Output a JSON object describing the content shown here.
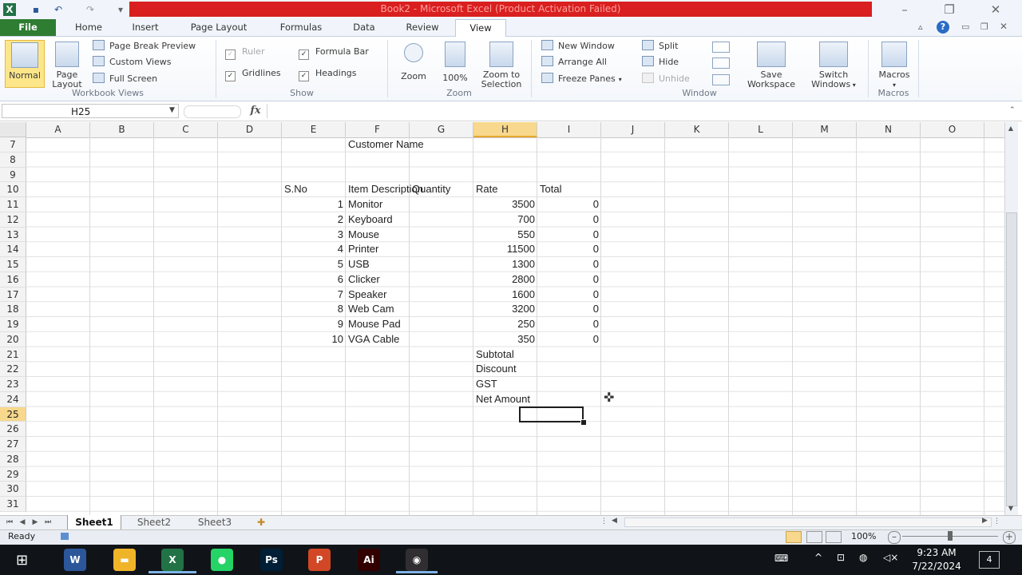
{
  "window": {
    "title": "Book2 - Microsoft Excel (Product Activation Failed)"
  },
  "ribbon_tabs": [
    "File",
    "Home",
    "Insert",
    "Page Layout",
    "Formulas",
    "Data",
    "Review",
    "View"
  ],
  "ribbon": {
    "workbook_views": {
      "label": "Workbook Views",
      "normal": "Normal",
      "page_layout_1": "Page",
      "page_layout_2": "Layout",
      "page_break_preview": "Page Break Preview",
      "custom_views": "Custom Views",
      "full_screen": "Full Screen"
    },
    "show": {
      "label": "Show",
      "ruler": "Ruler",
      "formula_bar": "Formula Bar",
      "gridlines": "Gridlines",
      "headings": "Headings"
    },
    "zoom": {
      "label": "Zoom",
      "zoom": "Zoom",
      "hundred": "100%",
      "zoom_to_1": "Zoom to",
      "zoom_to_2": "Selection"
    },
    "window": {
      "label": "Window",
      "new_window": "New Window",
      "arrange_all": "Arrange All",
      "freeze_panes": "Freeze Panes",
      "split": "Split",
      "hide": "Hide",
      "unhide": "Unhide",
      "save_1": "Save",
      "save_2": "Workspace",
      "switch_1": "Switch",
      "switch_2": "Windows"
    },
    "macros": {
      "label": "Macros",
      "macros": "Macros"
    }
  },
  "formula_bar": {
    "name_box": "H25",
    "fx": "fx",
    "value": ""
  },
  "columns": [
    "A",
    "B",
    "C",
    "D",
    "E",
    "F",
    "G",
    "H",
    "I",
    "J",
    "K",
    "L",
    "M",
    "N",
    "O"
  ],
  "rows": [
    "7",
    "8",
    "9",
    "10",
    "11",
    "12",
    "13",
    "14",
    "15",
    "16",
    "17",
    "18",
    "19",
    "20",
    "21",
    "22",
    "23",
    "24",
    "25",
    "26",
    "27",
    "28",
    "29",
    "30",
    "31"
  ],
  "sheet": {
    "customer_name": "Customer Name",
    "headers": {
      "sno": "S.No",
      "item": "Item Description",
      "qty": "Quantity",
      "rate": "Rate",
      "total": "Total"
    },
    "items": [
      {
        "sno": "1",
        "item": "Monitor",
        "rate": "3500",
        "total": "0"
      },
      {
        "sno": "2",
        "item": "Keyboard",
        "rate": "700",
        "total": "0"
      },
      {
        "sno": "3",
        "item": "Mouse",
        "rate": "550",
        "total": "0"
      },
      {
        "sno": "4",
        "item": "Printer",
        "rate": "11500",
        "total": "0"
      },
      {
        "sno": "5",
        "item": "USB",
        "rate": "1300",
        "total": "0"
      },
      {
        "sno": "6",
        "item": "Clicker",
        "rate": "2800",
        "total": "0"
      },
      {
        "sno": "7",
        "item": "Speaker",
        "rate": "1600",
        "total": "0"
      },
      {
        "sno": "8",
        "item": "Web Cam",
        "rate": "3200",
        "total": "0"
      },
      {
        "sno": "9",
        "item": "Mouse Pad",
        "rate": "250",
        "total": "0"
      },
      {
        "sno": "10",
        "item": "VGA Cable",
        "rate": "350",
        "total": "0"
      }
    ],
    "summary": [
      "Subtotal",
      "Discount",
      "GST",
      "Net Amount"
    ]
  },
  "sheet_tabs": [
    "Sheet1",
    "Sheet2",
    "Sheet3"
  ],
  "status": {
    "ready": "Ready",
    "zoom": "100%"
  },
  "taskbar": {
    "apps": [
      {
        "name": "word",
        "glyph": "W",
        "color": "#2b579a"
      },
      {
        "name": "file-explorer",
        "glyph": "▬",
        "color": "#f0b429"
      },
      {
        "name": "excel",
        "glyph": "X",
        "color": "#217346"
      },
      {
        "name": "whatsapp",
        "glyph": "●",
        "color": "#25d366"
      },
      {
        "name": "photoshop",
        "glyph": "Ps",
        "color": "#001e36"
      },
      {
        "name": "powerpoint",
        "glyph": "P",
        "color": "#d24726"
      },
      {
        "name": "illustrator",
        "glyph": "Ai",
        "color": "#330000"
      },
      {
        "name": "obs",
        "glyph": "◉",
        "color": "#302e31"
      }
    ],
    "time": "9:23 AM",
    "date": "7/22/2024",
    "notifications": "4"
  }
}
